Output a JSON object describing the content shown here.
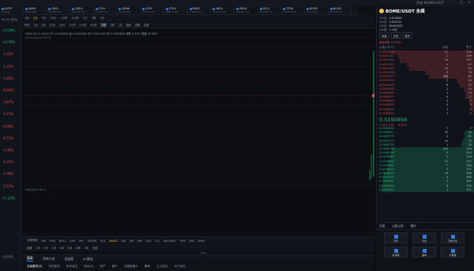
{
  "titlebar": {
    "label": "币安 BOME/USDT"
  },
  "tickers": [
    {
      "name": "JUPYT",
      "price": "0.4701"
    },
    {
      "name": "SAMO",
      "price": "0.017253"
    },
    {
      "name": "ORAI",
      "price": "3.1437 0.3"
    },
    {
      "name": "ORCA",
      "price": "4.1917 3.6"
    },
    {
      "name": "JTOU",
      "price": "3.5437 0.1"
    },
    {
      "name": "BONK",
      "price": "0.000026"
    },
    {
      "name": "JUPIY",
      "price": "0.9974 4.9"
    },
    {
      "name": "ETHU",
      "price": "3627 1.45"
    },
    {
      "name": "MANT",
      "price": "1.1657 4.1"
    },
    {
      "name": "WIFU",
      "price": "3.4175 0.4"
    },
    {
      "name": "MEUV",
      "price": "0.0019 7.3"
    },
    {
      "name": "XOLU",
      "price": "0.0215 3.9"
    },
    {
      "name": "STRK",
      "price": "1.8157 0.3"
    },
    {
      "name": "BOME",
      "price": "0.019 6.1"
    },
    {
      "name": "WLDU",
      "price": "8.7155 1.7"
    }
  ],
  "left": {
    "header": "市价单 涨跌幅",
    "changes": [
      "+0.39%",
      "+0.76%",
      "-1.02%",
      "-1.43%",
      "-1.82%",
      "-0.93%",
      "-3.67%",
      "-2.11%",
      "-2.06%",
      "-0.73%",
      "-3.36%",
      "-1.25%",
      "-1.99%",
      "-2.57%",
      "+1.22%"
    ],
    "footer": "自选列表"
  },
  "toolbar": {
    "row1": [
      "1秒",
      "1分",
      "5分",
      "15分",
      "1小时",
      "4小时",
      "1日",
      "1周",
      "1月"
    ],
    "row1_active": "1分",
    "row2": [
      "时间",
      "1分",
      "5分",
      "15分",
      "30分",
      "1小时",
      "2小时",
      "4小时",
      "1日",
      "1周",
      "1月",
      "指标",
      "设置",
      "全屏"
    ],
    "row2_active": "1日"
  },
  "chart": {
    "info": "2024-03-11 00:00  开 0.0190854  高 0.0240000  低 0.0101345  收 0.0190858  涨跌 0.49%  振幅 52.58%",
    "info2": "Volume(132,533,0)",
    "macd": "MACD(12,26,9)",
    "yaxis": [
      "0.0250000",
      "0.0240000",
      "0.0230000",
      "0.0220000",
      "0.0210000",
      "0.0200000",
      "0.0190000",
      "0.0180000",
      "0.0170000",
      "0.0160000",
      "0.0150000",
      "0.0140000",
      "0.0130000",
      "0.0120000",
      "0.0110000",
      "0.0100000"
    ],
    "price_tag": "0.0190858",
    "price_tag2": "00:29:59",
    "low_label": "0.004",
    "candle": {
      "open": 0.0190854,
      "high": 0.024,
      "low": 0.0101345,
      "close": 0.0190858,
      "ymin": 0.0095,
      "ymax": 0.0255
    }
  },
  "chartbar": {
    "items": [
      "主图指标",
      "MA",
      "EMA",
      "BOLL",
      "SAR",
      "AVL",
      "SUPER",
      "VOL",
      "MACD",
      "KDJ",
      "RSI",
      "WR",
      "OBV",
      "CCI",
      "StochRSI",
      "TRIX",
      "DMI",
      "DMA"
    ],
    "active": "MACD"
  },
  "chartbar2": [
    "隐藏",
    "1天",
    "5天",
    "1月",
    "3月",
    "6月",
    "今年",
    "1年",
    "全部"
  ],
  "scrollbar": "0001",
  "btabs": {
    "items": [
      "图表",
      "币种介绍",
      "深度图",
      "AI 解读"
    ],
    "active": "图表"
  },
  "btabs2": {
    "items": [
      "当前委托(0)",
      "历史委托",
      "历史成交",
      "持仓(0)",
      "资产",
      "账户",
      "交易机器人",
      "跟单",
      "主力成交",
      "大户成交"
    ],
    "active": "当前委托(0)"
  },
  "right": {
    "symbol": "BOME/USDT 永续",
    "stats": [
      {
        "k": "24h高",
        "v": "0.024000"
      },
      {
        "k": "24h低",
        "v": "0.010134"
      },
      {
        "k": "24h量",
        "v": "8546.85万"
      },
      {
        "k": "24h额",
        "v": "1.33亿"
      }
    ],
    "buttons": [
      "永续",
      "交割",
      "现货"
    ],
    "funding": "资金费率 -0.015%",
    "orderbook_header": [
      "价格(USDT)",
      "数量",
      "累计"
    ],
    "asks": [
      {
        "p": "0.0191329",
        "q": "11",
        "c": "120"
      },
      {
        "p": "0.0191252",
        "q": "2",
        "c": "109"
      },
      {
        "p": "0.0191215",
        "q": "10",
        "c": "107"
      },
      {
        "p": "0.0191162",
        "q": "4",
        "c": "97"
      },
      {
        "p": "0.0191124",
        "q": "23",
        "c": "93"
      },
      {
        "p": "0.0191103",
        "q": "5",
        "c": "70"
      },
      {
        "p": "0.0191077",
        "q": "486",
        "c": "65"
      },
      {
        "p": "0.0191054",
        "q": "3",
        "c": "24"
      },
      {
        "p": "0.0191021",
        "q": "6",
        "c": "21"
      },
      {
        "p": "0.0191003",
        "q": "2",
        "c": "15"
      },
      {
        "p": "0.0190985",
        "q": "1",
        "c": "13"
      },
      {
        "p": "0.0190971",
        "q": "5",
        "c": "12"
      },
      {
        "p": "0.0190944",
        "q": "2",
        "c": "7"
      },
      {
        "p": "0.0190933",
        "q": "3",
        "c": "5"
      },
      {
        "p": "0.0190915",
        "q": "1",
        "c": "2"
      },
      {
        "p": "0.0190902",
        "q": "1",
        "c": "1"
      }
    ],
    "mid_price": "0.0190858",
    "mid_change": "-0.0017795",
    "mid_pct": "-8.53%",
    "bids": [
      {
        "p": "0.0190832",
        "q": "7",
        "c": "7"
      },
      {
        "p": "0.0190811",
        "q": "52",
        "c": "59"
      },
      {
        "p": "0.0190795",
        "q": "2",
        "c": "61"
      },
      {
        "p": "0.0190771",
        "q": "14",
        "c": "75"
      },
      {
        "p": "0.0190750",
        "q": "1",
        "c": "76"
      },
      {
        "p": "0.0190728",
        "q": "433",
        "c": "509"
      },
      {
        "p": "0.0190709",
        "q": "5",
        "c": "514"
      },
      {
        "p": "0.0190682",
        "q": "2",
        "c": "516"
      },
      {
        "p": "0.0190660",
        "q": "11",
        "c": "527"
      },
      {
        "p": "0.0190641",
        "q": "7",
        "c": "534"
      },
      {
        "p": "0.0190620",
        "q": "3",
        "c": "537"
      },
      {
        "p": "0.0190603",
        "q": "19",
        "c": "556"
      },
      {
        "p": "0.0190587",
        "q": "4",
        "c": "560"
      },
      {
        "p": "0.0190561",
        "q": "2",
        "c": "562"
      },
      {
        "p": "0.0190540",
        "q": "8",
        "c": "570"
      },
      {
        "p": "0.0190522",
        "q": "1",
        "c": "571"
      }
    ],
    "trade_tabs": [
      "交易",
      "止盈止损",
      "限价"
    ],
    "tiles": [
      {
        "label": "开仓"
      },
      {
        "label": "平仓"
      },
      {
        "label": "闪电开仓"
      },
      {
        "label": "条件单"
      },
      {
        "label": "跟单"
      },
      {
        "label": "计算器"
      }
    ]
  }
}
